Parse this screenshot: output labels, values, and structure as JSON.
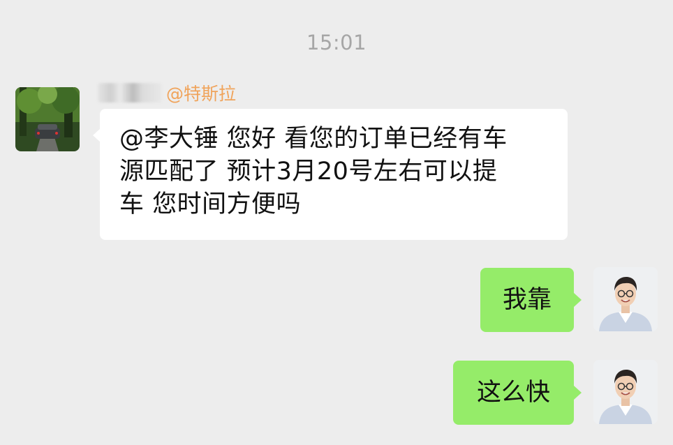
{
  "timestamp": "15:01",
  "messages": {
    "incoming": {
      "sender_tag": "@特斯拉",
      "lines": [
        "@李大锤 您好 看您的订单已经有车",
        "源匹配了  预计3月20号左右可以提",
        "车  您时间方便吗"
      ]
    },
    "outgoing": [
      {
        "text": "我靠"
      },
      {
        "text": "这么快"
      }
    ]
  },
  "colors": {
    "background": "#ededed",
    "incoming_bubble": "#ffffff",
    "outgoing_bubble": "#95ec69",
    "sender_tag": "#f0a35a",
    "timestamp": "#a6a6a6"
  },
  "icons": {
    "incoming_avatar": "car-in-forest-avatar",
    "outgoing_avatar": "man-portrait-avatar"
  }
}
